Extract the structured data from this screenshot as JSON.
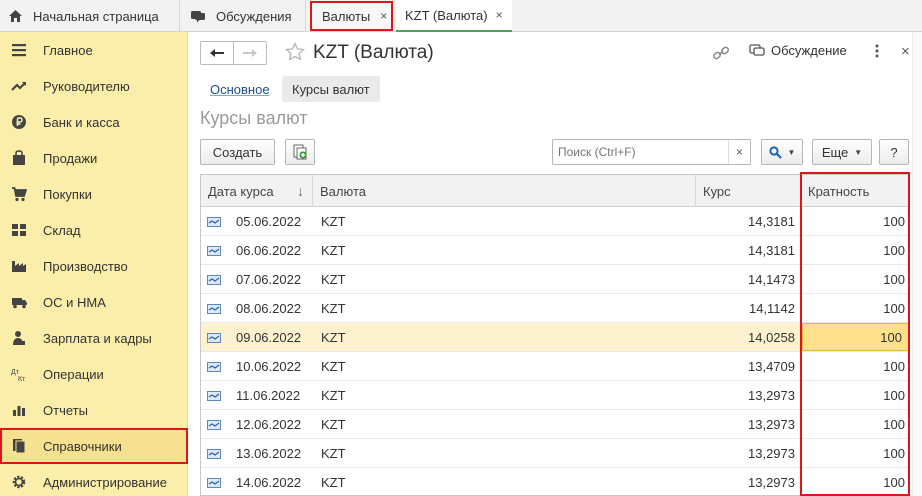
{
  "tabs": {
    "home": "Начальная страница",
    "discussions": "Обсуждения",
    "currencies": "Валюты",
    "kzt": "KZT (Валюта)",
    "close_glyph": "×"
  },
  "sidebar": {
    "items": [
      {
        "label": "Главное",
        "icon": "menu-lines-icon"
      },
      {
        "label": "Руководителю",
        "icon": "trend-icon"
      },
      {
        "label": "Банк и касса",
        "icon": "ruble-icon"
      },
      {
        "label": "Продажи",
        "icon": "bag-icon"
      },
      {
        "label": "Покупки",
        "icon": "cart-icon"
      },
      {
        "label": "Склад",
        "icon": "grid-icon"
      },
      {
        "label": "Производство",
        "icon": "factory-icon"
      },
      {
        "label": "ОС и НМА",
        "icon": "truck-icon"
      },
      {
        "label": "Зарплата и кадры",
        "icon": "person-icon"
      },
      {
        "label": "Операции",
        "icon": "dt-kt-icon"
      },
      {
        "label": "Отчеты",
        "icon": "bar-chart-icon"
      },
      {
        "label": "Справочники",
        "icon": "book-icon"
      },
      {
        "label": "Администрирование",
        "icon": "gear-icon"
      }
    ]
  },
  "form": {
    "title": "KZT (Валюта)",
    "discussion_label": "Обсуждение",
    "subtabs": {
      "main": "Основное",
      "rates": "Курсы валют"
    },
    "section_title": "Курсы валют",
    "create_label": "Создать",
    "search_placeholder": "Поиск (Ctrl+F)",
    "more_label": "Еще",
    "help_label": "?",
    "clear_glyph": "×"
  },
  "table": {
    "columns": {
      "date": "Дата курса",
      "currency": "Валюта",
      "rate": "Курс",
      "multiplicity": "Кратность"
    },
    "sort_glyph": "↓",
    "rows": [
      {
        "date": "05.06.2022",
        "currency": "KZT",
        "rate": "14,3181",
        "multiplicity": "100"
      },
      {
        "date": "06.06.2022",
        "currency": "KZT",
        "rate": "14,3181",
        "multiplicity": "100"
      },
      {
        "date": "07.06.2022",
        "currency": "KZT",
        "rate": "14,1473",
        "multiplicity": "100"
      },
      {
        "date": "08.06.2022",
        "currency": "KZT",
        "rate": "14,1142",
        "multiplicity": "100"
      },
      {
        "date": "09.06.2022",
        "currency": "KZT",
        "rate": "14,0258",
        "multiplicity": "100"
      },
      {
        "date": "10.06.2022",
        "currency": "KZT",
        "rate": "13,4709",
        "multiplicity": "100"
      },
      {
        "date": "11.06.2022",
        "currency": "KZT",
        "rate": "13,2973",
        "multiplicity": "100"
      },
      {
        "date": "12.06.2022",
        "currency": "KZT",
        "rate": "13,2973",
        "multiplicity": "100"
      },
      {
        "date": "13.06.2022",
        "currency": "KZT",
        "rate": "13,2973",
        "multiplicity": "100"
      },
      {
        "date": "14.06.2022",
        "currency": "KZT",
        "rate": "13,2973",
        "multiplicity": "100"
      }
    ],
    "selected_row": 4
  },
  "colors": {
    "highlight_red": "#e0151c",
    "sidebar_bg": "#fbeeaa",
    "selected_row": "#fdf2cf",
    "link_blue": "#1c4e8e"
  }
}
